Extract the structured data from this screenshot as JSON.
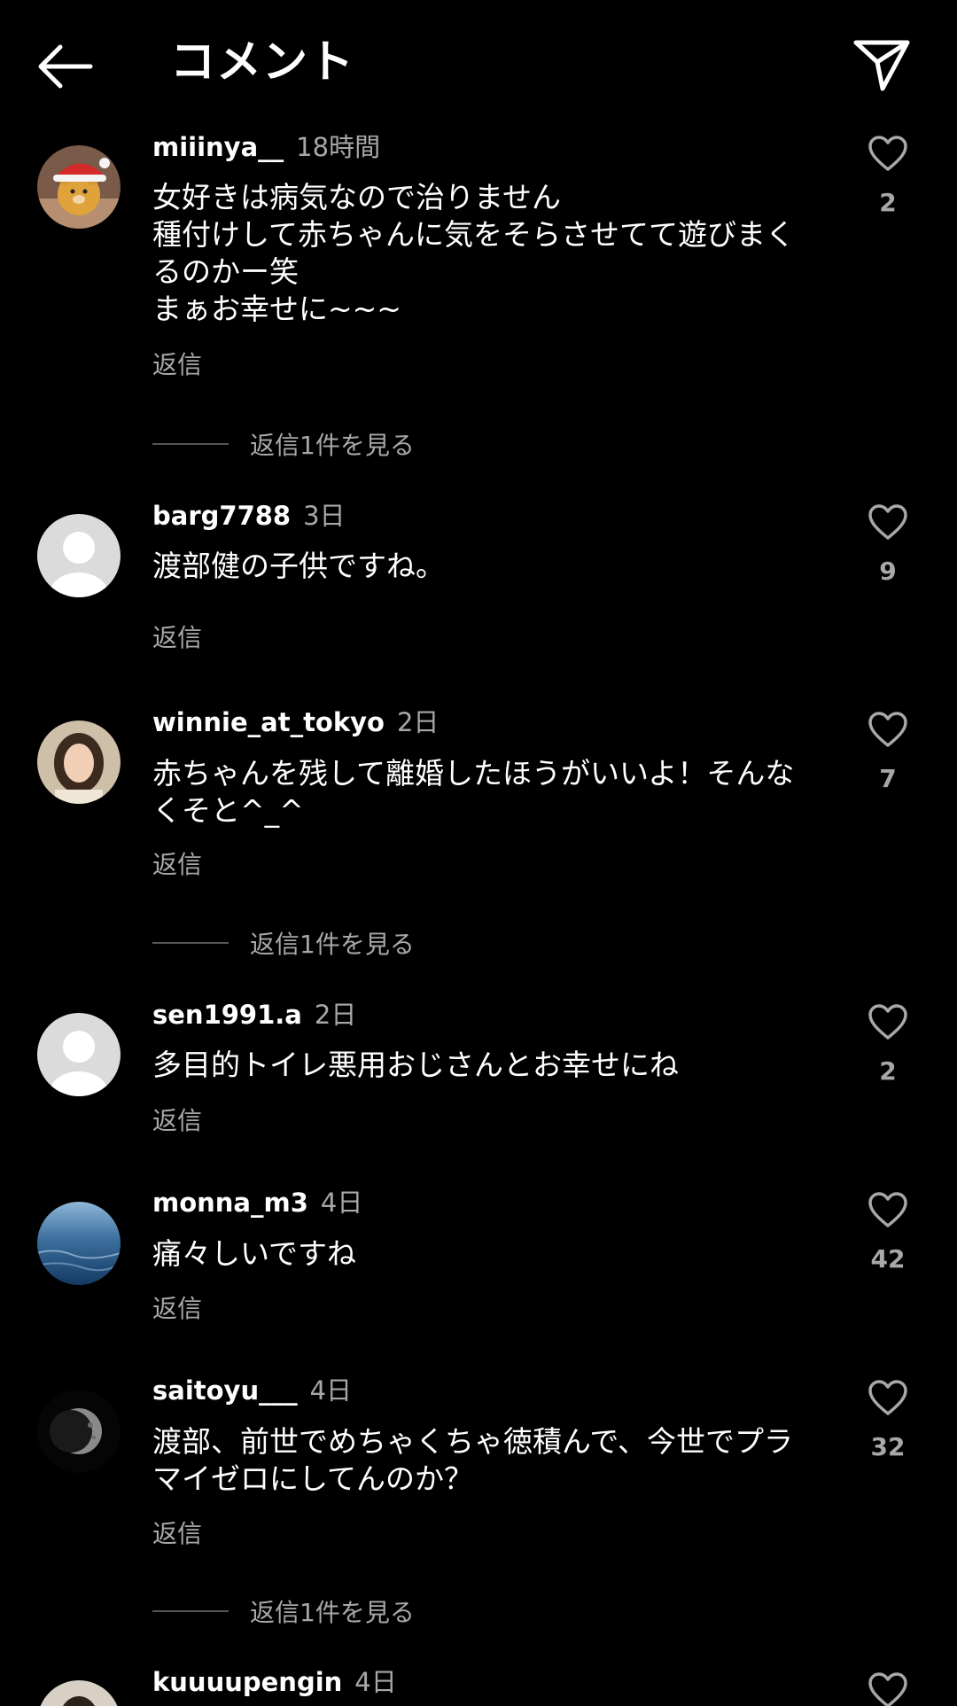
{
  "header": {
    "title": "コメント"
  },
  "comments": [
    {
      "username": "miiinya__",
      "time": "18時間",
      "text": "女好きは病気なので治りません\n種付けして赤ちゃんに気をそらさせてて遊びまく\nるのかー笑\nまぁお幸せに~~~",
      "reply": "返信",
      "likes": "2",
      "view_replies": "返信1件を見る",
      "avatar": "bear-avatar"
    },
    {
      "username": "barg7788",
      "time": "3日",
      "text": "渡部健の子供ですね。",
      "reply": "返信",
      "likes": "9",
      "avatar": "default-avatar"
    },
    {
      "username": "winnie_at_tokyo",
      "time": "2日",
      "text": "赤ちゃんを残して離婚したほうがいいよ！そんな\nくそと^_^",
      "reply": "返信",
      "likes": "7",
      "view_replies": "返信1件を見る",
      "avatar": "woman-avatar"
    },
    {
      "username": "sen1991.a",
      "time": "2日",
      "text": "多目的トイレ悪用おじさんとお幸せにね",
      "reply": "返信",
      "likes": "2",
      "avatar": "default-avatar"
    },
    {
      "username": "monna_m3",
      "time": "4日",
      "text": "痛々しいですね",
      "reply": "返信",
      "likes": "42",
      "avatar": "ocean-avatar"
    },
    {
      "username": "saitoyu___",
      "time": "4日",
      "text": "渡部、前世でめちゃくちゃ徳積んで、今世でプラ\nマイゼロにしてんのか？",
      "reply": "返信",
      "likes": "32",
      "view_replies": "返信1件を見る",
      "avatar": "moon-avatar"
    },
    {
      "username": "kuuuupengin",
      "time": "4日",
      "avatar": "man-avatar"
    }
  ],
  "colors": {
    "background": "#000000",
    "secondary_text": "#a8a8a8",
    "primary_text": "#ffffff"
  }
}
